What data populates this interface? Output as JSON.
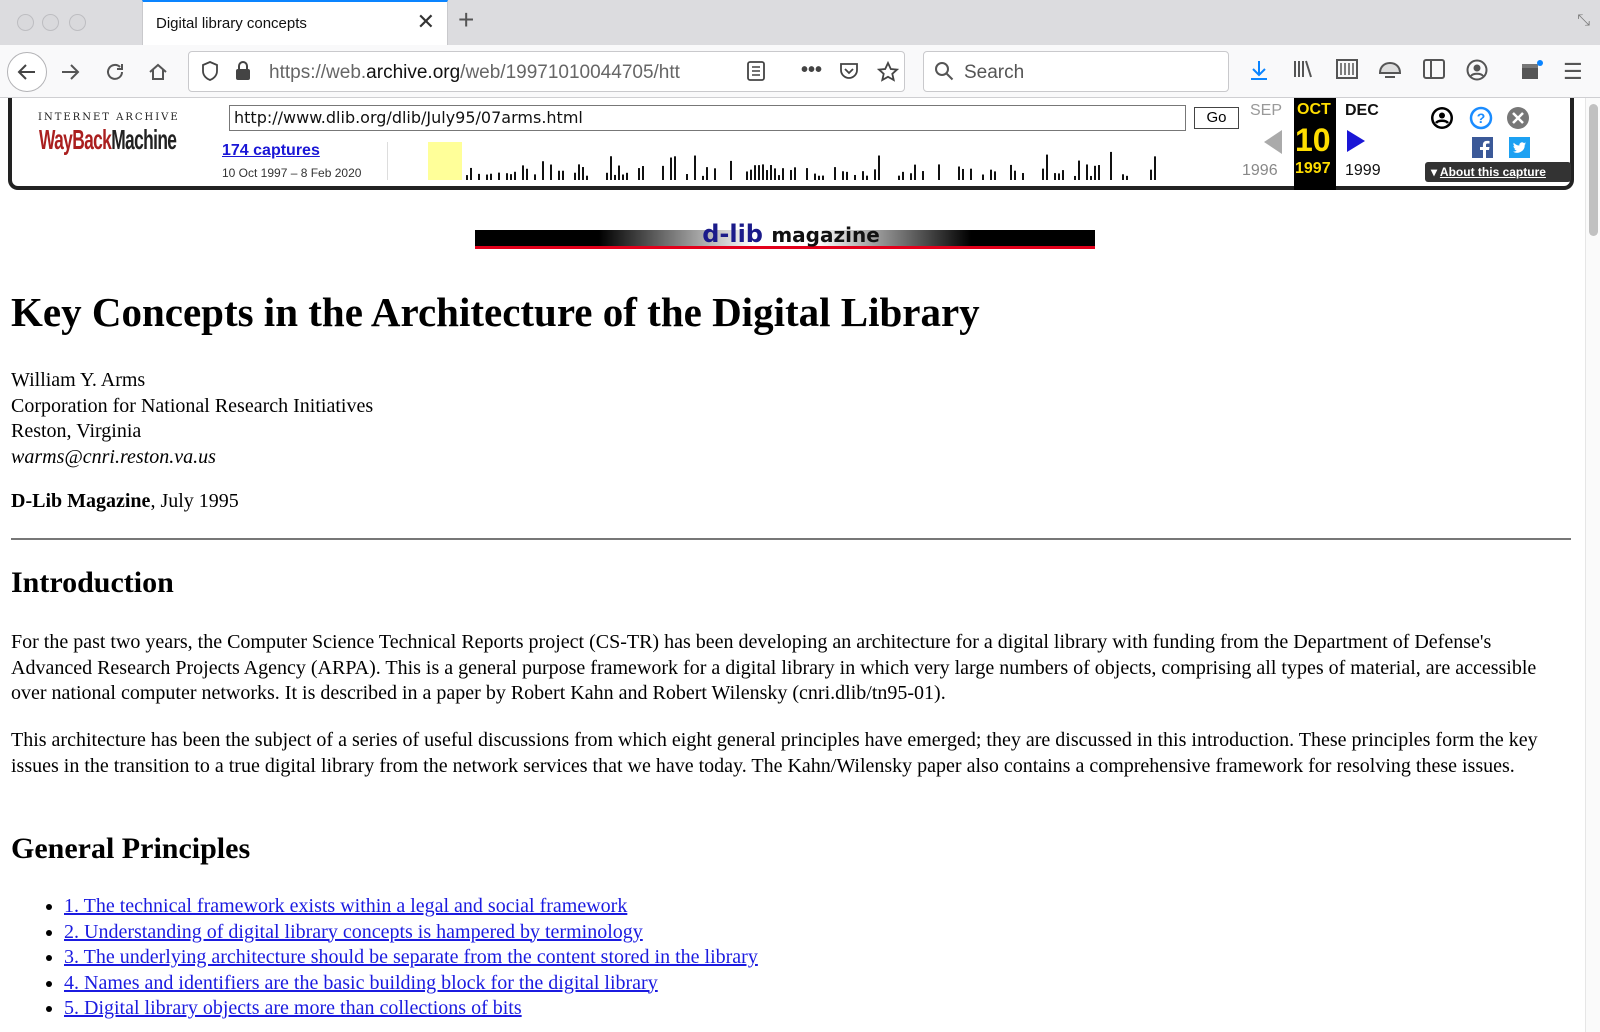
{
  "browser": {
    "tab_title": "Digital library concepts",
    "tab_close": "✕",
    "new_tab": "+",
    "url_prefix": "https://web.",
    "url_domain": "archive.org",
    "url_rest": "/web/19971010044705/htt",
    "search_placeholder": "Search"
  },
  "wayback": {
    "logo_top": "INTERNET ARCHIVE",
    "logo_main_1": "WayBack",
    "logo_main_2": "Machine",
    "url_value": "http://www.dlib.org/dlib/July95/07arms.html",
    "go_label": "Go",
    "captures": "174 captures",
    "range": "10 Oct 1997 – 8 Feb 2020",
    "prev_month": "SEP",
    "cur_month": "OCT",
    "cur_day": "10",
    "cur_year": "1997",
    "next_month": "DEC",
    "prev_year": "1996",
    "next_year": "1999",
    "about": "About this capture"
  },
  "page": {
    "banner_dlib": "d-lib",
    "banner_mag": "magazine",
    "title": "Key Concepts in the Architecture of the Digital Library",
    "author_name": "William Y. Arms",
    "author_org": "Corporation for National Research Initiatives",
    "author_loc": "Reston, Virginia",
    "author_email": "warms@cnri.reston.va.us",
    "citation_mag": "D-Lib Magazine",
    "citation_date": ", July 1995",
    "intro_heading": "Introduction",
    "intro_p1": "For the past two years, the Computer Science Technical Reports project (CS-TR) has been developing an architecture for a digital library with funding from the Department of Defense's Advanced Research Projects Agency (ARPA). This is a general purpose framework for a digital library in which very large numbers of objects, comprising all types of material, are accessible over national computer networks. It is described in a paper by Robert Kahn and Robert Wilensky (cnri.dlib/tn95-01).",
    "intro_p2": "This architecture has been the subject of a series of useful discussions from which eight general principles have emerged; they are discussed in this introduction. These principles form the key issues in the transition to a true digital library from the network services that we have today. The Kahn/Wilensky paper also contains a comprehensive framework for resolving these issues.",
    "gp_heading": "General Principles",
    "principles": [
      "1. The technical framework exists within a legal and social framework",
      "2. Understanding of digital library concepts is hampered by terminology",
      "3. The underlying architecture should be separate from the content stored in the library",
      "4. Names and identifiers are the basic building block for the digital library",
      "5. Digital library objects are more than collections of bits"
    ]
  },
  "colors": {
    "link": "#1b1be0",
    "wayback_red": "#aa1f1f",
    "wayback_yellow": "#ffdd00",
    "banner_red": "#e3001b"
  }
}
